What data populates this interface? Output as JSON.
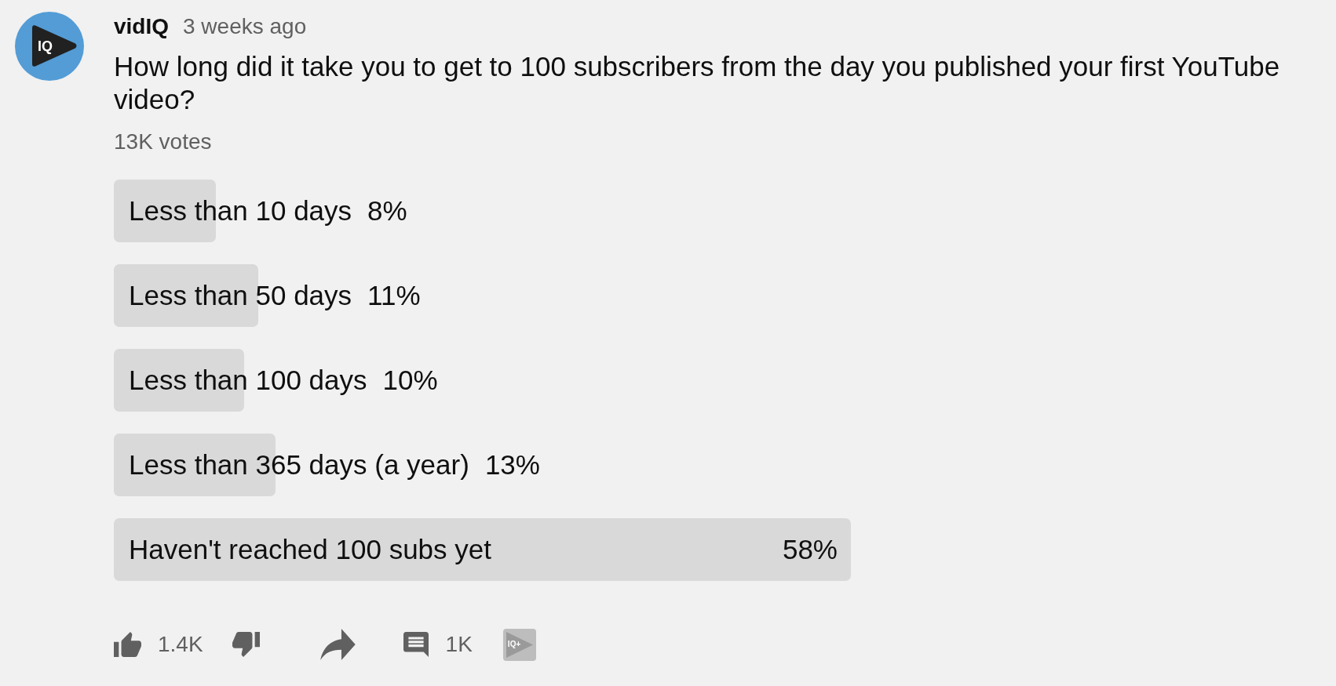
{
  "post": {
    "avatar_text": "IQ",
    "author": "vidIQ",
    "time": "3 weeks ago",
    "text": "How long did it take you to get to 100 subscribers from the day you published your first YouTube video?",
    "votes": "13K votes"
  },
  "poll": {
    "options": [
      {
        "label": "Less than 10 days",
        "percent": "8%",
        "level": 0.138
      },
      {
        "label": "Less than 50 days",
        "percent": "11%",
        "level": 0.196
      },
      {
        "label": "Less than 100 days",
        "percent": "10%",
        "level": 0.177
      },
      {
        "label": "Less than 365 days (a year)",
        "percent": "13%",
        "level": 0.219
      },
      {
        "label": "Haven't reached 100 subs yet",
        "percent": "58%",
        "level": 1
      }
    ]
  },
  "actions": {
    "like_count": "1.4K",
    "comment_count": "1K",
    "logo_text": "IQ+"
  }
}
